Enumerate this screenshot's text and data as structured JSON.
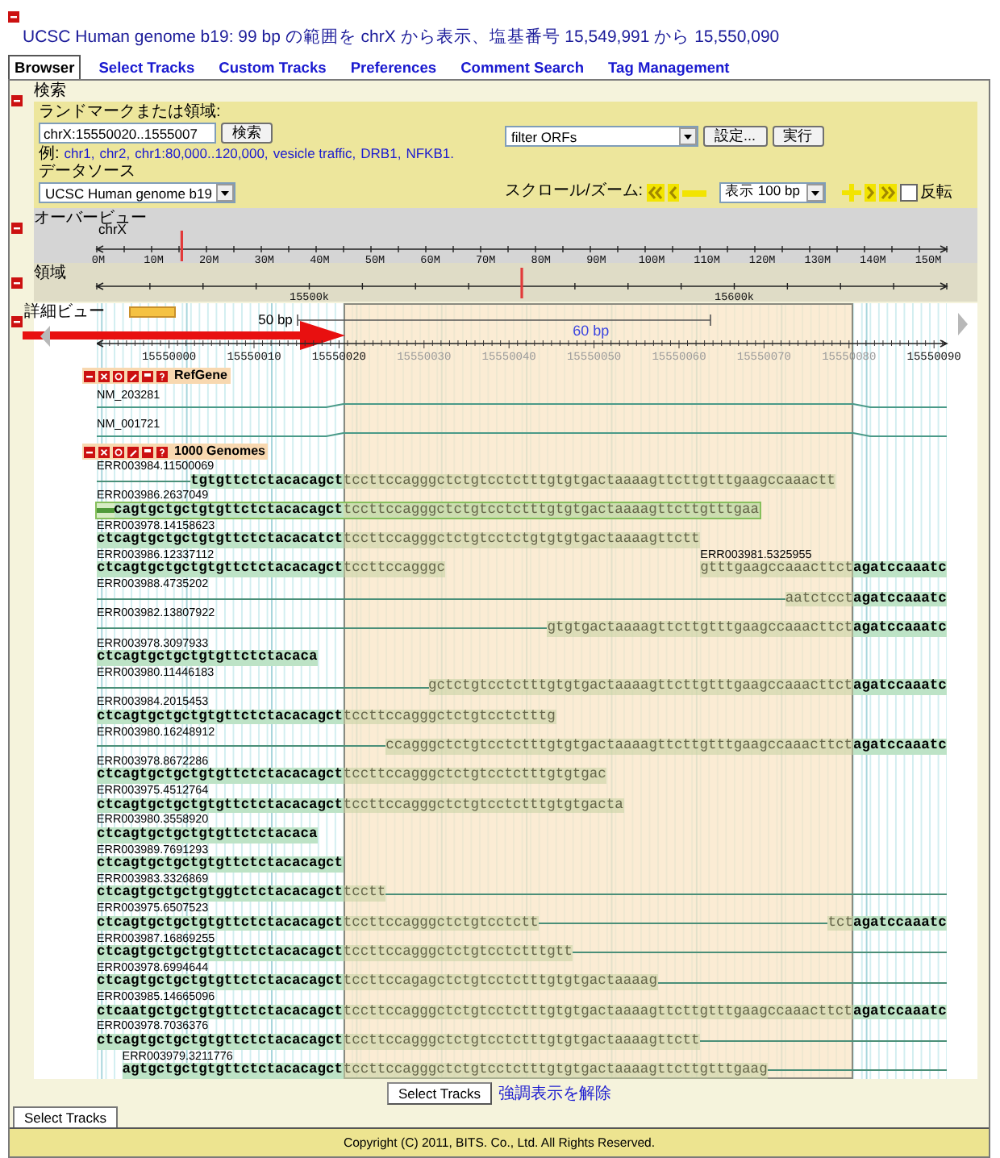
{
  "title": "UCSC Human genome b19: 99 bp の範囲を chrX から表示、塩基番号 15,549,991 から 15,550,090",
  "tabs": [
    {
      "label": "Browser",
      "selected": true
    },
    {
      "label": "Select Tracks",
      "selected": false
    },
    {
      "label": "Custom Tracks",
      "selected": false
    },
    {
      "label": "Preferences",
      "selected": false
    },
    {
      "label": "Comment Search",
      "selected": false
    },
    {
      "label": "Tag Management",
      "selected": false
    }
  ],
  "search": {
    "title": "検索",
    "landmark_label": "ランドマークまたは領域:",
    "landmark_value": "chrX:15550020..1555007",
    "search_button": "検索",
    "filter": "filter ORFs",
    "settings_button": "設定...",
    "run_button": "実行",
    "examples_label": "例:",
    "examples": [
      "chr1,",
      "chr2,",
      "chr1:80,000..120,000,",
      "vesicle traffic,",
      "DRB1,",
      "NFKB1."
    ],
    "source_label": "データソース",
    "source": "UCSC Human genome b19",
    "zoom_label": "スクロール/ズーム:",
    "zoom": "表示 100 bp",
    "flip": {
      "label": "反転",
      "checked": false
    }
  },
  "overview": {
    "title": "オーバービュー",
    "chromosome": "chrX",
    "ticks": [
      "0M",
      "10M",
      "20M",
      "30M",
      "40M",
      "50M",
      "60M",
      "70M",
      "80M",
      "90M",
      "100M",
      "110M",
      "120M",
      "130M",
      "140M",
      "150M"
    ],
    "level": 0.1
  },
  "region": {
    "title": "領域",
    "ticks": [
      "15500k",
      "15600k"
    ],
    "level": 0.5
  },
  "detail": {
    "title": "詳細ビュー",
    "scale_label": "50 bp",
    "ruler_labels": [
      "15550000",
      "15550010",
      "15550020",
      "15550030",
      "15550040",
      "15550050",
      "15550060",
      "15550070",
      "15550080",
      "15550090"
    ],
    "ruler_note": "60 bp",
    "refgene": {
      "title": "RefGene",
      "genes": [
        "NM_203281",
        "NM_001721"
      ]
    },
    "genomes": {
      "title": "1000 Genomes",
      "rows": [
        {
          "reads": [
            {
              "name": "ERR003984.11500069",
              "selected": false,
              "segments": [
                {
                  "kind": "line"
                },
                {
                  "kind": "left",
                  "text": "tgtgttctctacacagct"
                },
                {
                  "kind": "mid",
                  "text": "tccttccagggctctgtcctctttgtgtgactaaaagttcttgtttgaagccaaactt"
                }
              ]
            }
          ]
        },
        {
          "reads": [
            {
              "name": "ERR003986.2637049",
              "selected": true,
              "segments": [
                {
                  "kind": "line"
                },
                {
                  "kind": "left",
                  "text": "cagtgctgctgtgttctctacacagct"
                },
                {
                  "kind": "mid",
                  "text": "tccttccagggctctgtcctctttgtgtgactaaaagttcttgtttgaa"
                }
              ]
            }
          ]
        },
        {
          "reads": [
            {
              "name": "ERR003978.14158623",
              "selected": false,
              "segments": [
                {
                  "kind": "left",
                  "text": "ctcagtgctgctgtgttctctacacatct"
                },
                {
                  "kind": "mid",
                  "text": "tccttccagggctctgtcctctgtgtgtgactaaaagttctt"
                }
              ]
            }
          ]
        },
        {
          "reads": [
            {
              "name": "ERR003986.12337112",
              "selected": false,
              "segments": [
                {
                  "kind": "left",
                  "text": "ctcagtgctgctgtgttctctacacagct"
                },
                {
                  "kind": "mid",
                  "text": "tccttccagggc"
                }
              ]
            },
            {
              "name": "ERR003981.5325955",
              "selected": false,
              "segments": [
                {
                  "kind": "mid",
                  "text": "gtttgaagccaaacttct"
                },
                {
                  "kind": "right",
                  "text": "agatccaaatc"
                }
              ]
            }
          ]
        },
        {
          "reads": [
            {
              "name": "ERR003988.4735202",
              "selected": false,
              "segments": [
                {
                  "kind": "line"
                },
                {
                  "kind": "mid",
                  "text": "aatctcct"
                },
                {
                  "kind": "right",
                  "text": "agatccaaatc"
                }
              ]
            }
          ]
        },
        {
          "reads": [
            {
              "name": "ERR003982.13807922",
              "selected": false,
              "segments": [
                {
                  "kind": "line"
                },
                {
                  "kind": "mid",
                  "text": "gtgtgactaaaagttcttgtttgaagccaaacttct"
                },
                {
                  "kind": "right",
                  "text": "agatccaaatc"
                }
              ]
            }
          ]
        },
        {
          "reads": [
            {
              "name": "ERR003978.3097933",
              "selected": false,
              "segments": [
                {
                  "kind": "left",
                  "text": "ctcagtgctgctgtgttctctacaca"
                }
              ]
            }
          ]
        },
        {
          "reads": [
            {
              "name": "ERR003980.11446183",
              "selected": false,
              "segments": [
                {
                  "kind": "line"
                },
                {
                  "kind": "mid",
                  "text": "gctctgtcctctttgtgtgactaaaagttcttgtttgaagccaaacttct"
                },
                {
                  "kind": "right",
                  "text": "agatccaaatc"
                }
              ]
            }
          ]
        },
        {
          "reads": [
            {
              "name": "ERR003984.2015453",
              "selected": false,
              "segments": [
                {
                  "kind": "left",
                  "text": "ctcagtgctgctgtgttctctacacagct"
                },
                {
                  "kind": "mid",
                  "text": "tccttccagggctctgtcctctttg"
                }
              ]
            }
          ]
        },
        {
          "reads": [
            {
              "name": "ERR003980.16248912",
              "selected": false,
              "segments": [
                {
                  "kind": "line"
                },
                {
                  "kind": "mid",
                  "text": "ccagggctctgtcctctttgtgtgactaaaagttcttgtttgaagccaaacttct"
                },
                {
                  "kind": "right",
                  "text": "agatccaaatc"
                }
              ]
            }
          ]
        },
        {
          "reads": [
            {
              "name": "ERR003978.8672286",
              "selected": false,
              "segments": [
                {
                  "kind": "left",
                  "text": "ctcagtgctgctgtgttctctacacagct"
                },
                {
                  "kind": "mid",
                  "text": "tccttccagggctctgtcctctttgtgtgac"
                }
              ]
            }
          ]
        },
        {
          "reads": [
            {
              "name": "ERR003975.4512764",
              "selected": false,
              "segments": [
                {
                  "kind": "left",
                  "text": "ctcagtgctgctgtgttctctacacagct"
                },
                {
                  "kind": "mid",
                  "text": "tccttccagggctctgtcctctttgtgtgacta"
                }
              ]
            }
          ]
        },
        {
          "reads": [
            {
              "name": "ERR003980.3558920",
              "selected": false,
              "segments": [
                {
                  "kind": "left",
                  "text": "ctcagtgctgctgtgttctctacaca"
                }
              ]
            }
          ]
        },
        {
          "reads": [
            {
              "name": "ERR003989.7691293",
              "selected": false,
              "segments": [
                {
                  "kind": "left",
                  "text": "ctcagtgctgctgtgttctctacacagct"
                }
              ]
            }
          ]
        },
        {
          "reads": [
            {
              "name": "ERR003983.3326869",
              "selected": false,
              "segments": [
                {
                  "kind": "left",
                  "text": "ctcagtgctgctgtggtctctacacagct"
                },
                {
                  "kind": "mid",
                  "text": "tcctt"
                },
                {
                  "kind": "line"
                }
              ]
            }
          ]
        },
        {
          "reads": [
            {
              "name": "ERR003975.6507523",
              "selected": false,
              "segments": [
                {
                  "kind": "left",
                  "text": "ctcagtgctgctgtgttctctacacagct"
                },
                {
                  "kind": "mid",
                  "text": "tccttccagggctctgtcctctt"
                },
                {
                  "kind": "line"
                },
                {
                  "kind": "mid",
                  "text": "tct"
                },
                {
                  "kind": "right",
                  "text": "agatccaaatc"
                }
              ]
            }
          ]
        },
        {
          "reads": [
            {
              "name": "ERR003987.16869255",
              "selected": false,
              "segments": [
                {
                  "kind": "left",
                  "text": "ctcagtgctgctgtgttctctacacagct"
                },
                {
                  "kind": "mid",
                  "text": "tccttccagggctctgtcctctttgtt"
                },
                {
                  "kind": "line"
                }
              ]
            }
          ]
        },
        {
          "reads": [
            {
              "name": "ERR003978.6994644",
              "selected": false,
              "segments": [
                {
                  "kind": "left",
                  "text": "ctcagtgctgctgtgttctctacacagct"
                },
                {
                  "kind": "mid",
                  "text": "tccttccagagctctgtcctctttgtgtgactaaaag"
                },
                {
                  "kind": "line"
                }
              ]
            }
          ]
        },
        {
          "reads": [
            {
              "name": "ERR003985.14665096",
              "selected": false,
              "segments": [
                {
                  "kind": "left",
                  "text": "ctcaatgctgctgtgttctctacacagct"
                },
                {
                  "kind": "mid",
                  "text": "tccttccagggctctgtcctctttgtgtgactaaaagttcttgtttgaagccaaacttct"
                },
                {
                  "kind": "right",
                  "text": "agatccaaatc"
                }
              ]
            }
          ]
        },
        {
          "reads": [
            {
              "name": "ERR003978.7036376",
              "selected": false,
              "segments": [
                {
                  "kind": "left",
                  "text": "ctcagtgctgctgtgttctctacacagct"
                },
                {
                  "kind": "mid",
                  "text": "tccttccagggctctgtcctctttgtgtgactaaaagttctt"
                },
                {
                  "kind": "line"
                }
              ]
            }
          ]
        },
        {
          "reads": [
            {
              "name": "ERR003979.3211776",
              "selected": false,
              "segments": [
                {
                  "kind": "left",
                  "text": "agtgctgctgtgttctctacacagct"
                },
                {
                  "kind": "mid",
                  "text": "tccttccagggctctgtcctctttgtgtgactaaaagttcttgtttgaag"
                },
                {
                  "kind": "line"
                }
              ]
            }
          ]
        }
      ]
    }
  },
  "bottom": {
    "button": "Select Tracks",
    "link": "強調表示を解除"
  },
  "footer_tab": "Select Tracks",
  "copyright": "Copyright (C) 2011, BITS. Co., Ltd. All Rights Reserved."
}
